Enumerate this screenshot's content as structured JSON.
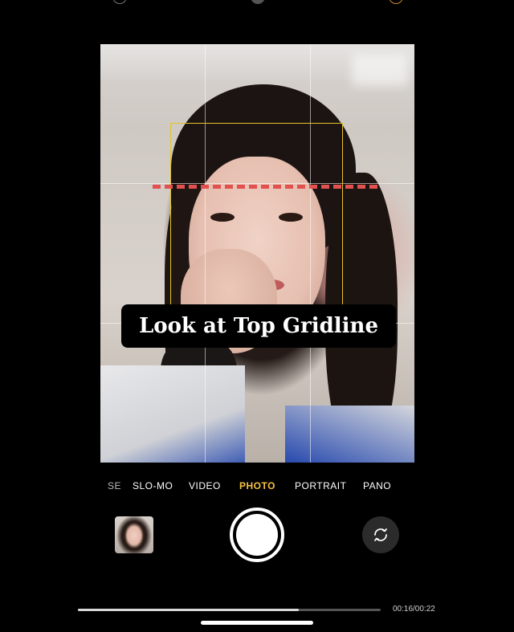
{
  "caption": {
    "text": "Look at Top Gridline"
  },
  "camera_modes": {
    "items": [
      "SE",
      "SLO-MO",
      "VIDEO",
      "PHOTO",
      "PORTRAIT",
      "PANO"
    ],
    "selected": "PHOTO"
  },
  "controls": {
    "thumbnail_icon": "last-photo-thumbnail",
    "shutter_icon": "shutter-button",
    "flip_icon": "camera-flip-icon"
  },
  "video_player": {
    "timestamp": "00:16/00:22",
    "progress": 0.73
  },
  "colors": {
    "selected_mode": "#f6c243",
    "focus_box": "#e6c229",
    "guide_line": "#e2514f",
    "background": "#000000"
  }
}
